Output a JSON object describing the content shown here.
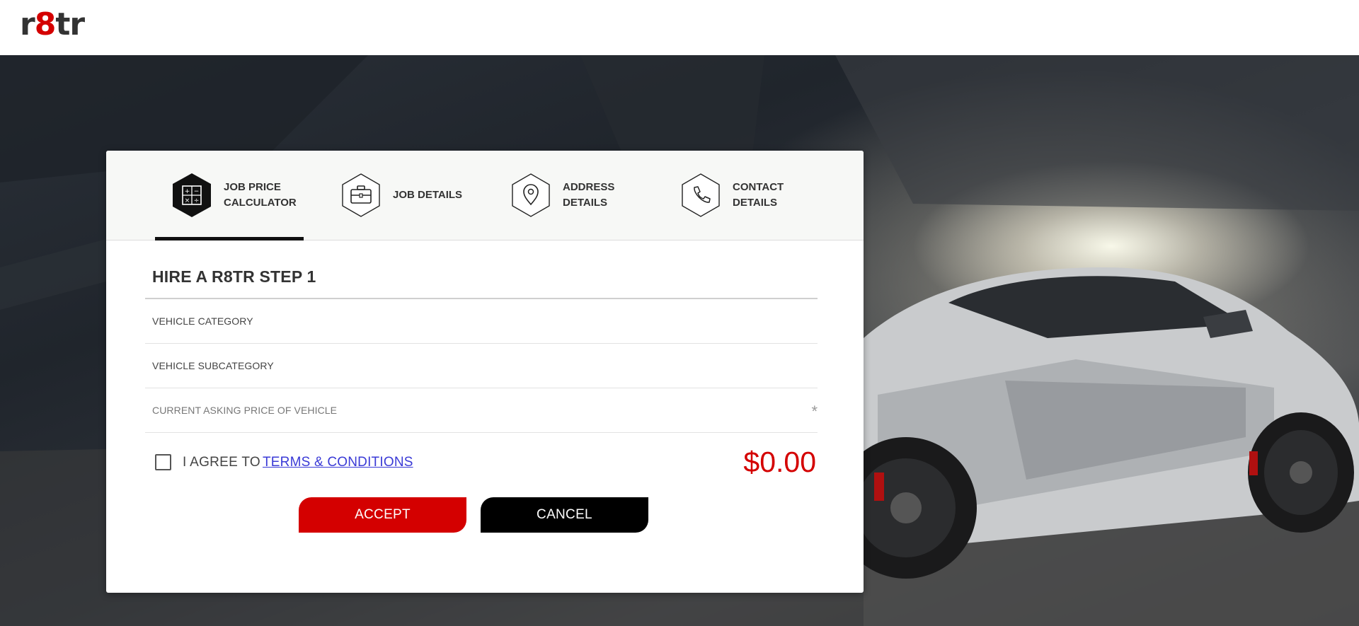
{
  "brand": {
    "logo_r": "r",
    "logo_8": "8",
    "logo_tr": "tr"
  },
  "steps": [
    {
      "label_line1": "JOB PRICE",
      "label_line2": "CALCULATOR",
      "icon": "calculator-icon",
      "active": true
    },
    {
      "label_line1": "JOB DETAILS",
      "label_line2": "",
      "icon": "briefcase-icon",
      "active": false
    },
    {
      "label_line1": "ADDRESS",
      "label_line2": "DETAILS",
      "icon": "map-pin-icon",
      "active": false
    },
    {
      "label_line1": "CONTACT",
      "label_line2": "DETAILS",
      "icon": "phone-icon",
      "active": false
    }
  ],
  "form": {
    "title": "HIRE A R8TR STEP 1",
    "vehicle_category_label": "VEHICLE CATEGORY",
    "vehicle_subcategory_label": "VEHICLE SUBCATEGORY",
    "price_label": "CURRENT ASKING PRICE OF VEHICLE",
    "required_mark": "*",
    "agree_text": "I AGREE TO",
    "terms_link": "TERMS & CONDITIONS",
    "total": "$0.00",
    "accept_label": "ACCEPT",
    "cancel_label": "CANCEL"
  },
  "colors": {
    "accent": "#d40000",
    "dark": "#111111",
    "link": "#3a3ad6"
  }
}
